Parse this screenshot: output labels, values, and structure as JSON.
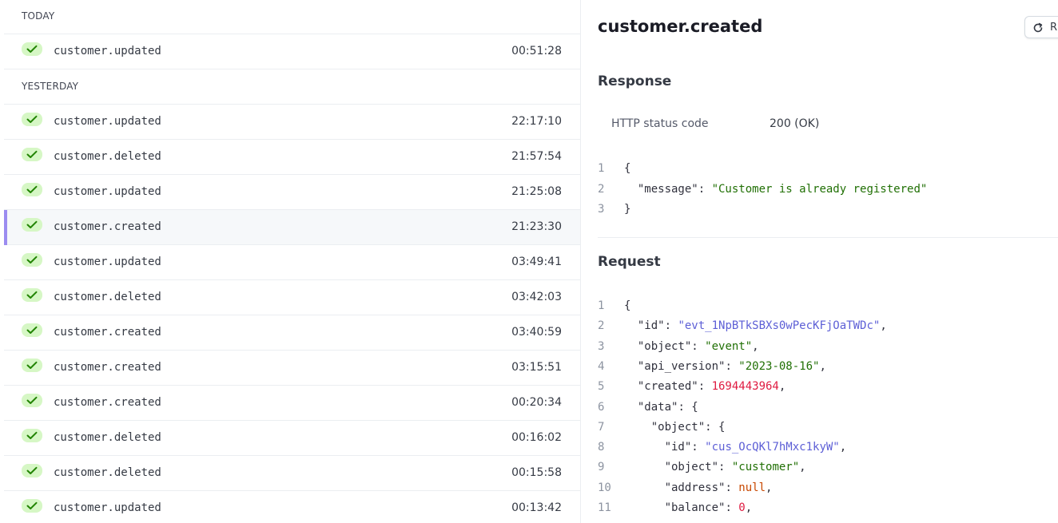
{
  "events_list": {
    "groups": [
      {
        "label": "TODAY",
        "rows": [
          {
            "name": "customer.updated",
            "time": "00:51:28"
          }
        ]
      },
      {
        "label": "YESTERDAY",
        "rows": [
          {
            "name": "customer.updated",
            "time": "22:17:10"
          },
          {
            "name": "customer.deleted",
            "time": "21:57:54"
          },
          {
            "name": "customer.updated",
            "time": "21:25:08"
          },
          {
            "name": "customer.created",
            "time": "21:23:30",
            "selected": true
          },
          {
            "name": "customer.updated",
            "time": "03:49:41"
          },
          {
            "name": "customer.deleted",
            "time": "03:42:03"
          },
          {
            "name": "customer.created",
            "time": "03:40:59"
          },
          {
            "name": "customer.created",
            "time": "03:15:51"
          },
          {
            "name": "customer.created",
            "time": "00:20:34"
          },
          {
            "name": "customer.deleted",
            "time": "00:16:02"
          },
          {
            "name": "customer.deleted",
            "time": "00:15:58"
          },
          {
            "name": "customer.updated",
            "time": "00:13:42"
          }
        ]
      }
    ],
    "status_icon": "check-icon"
  },
  "detail": {
    "title": "customer.created",
    "resend_label": "R",
    "resend_icon": "refresh-icon",
    "response": {
      "heading": "Response",
      "status_label": "HTTP status code",
      "status_value": "200 (OK)",
      "body_lines": [
        [
          [
            "{",
            "k"
          ]
        ],
        [
          [
            "  ",
            "k"
          ],
          [
            "\"message\"",
            "k"
          ],
          [
            ": ",
            "k"
          ],
          [
            "\"Customer is already registered\"",
            "s"
          ]
        ],
        [
          [
            "}",
            "k"
          ]
        ]
      ]
    },
    "request": {
      "heading": "Request",
      "body_lines": [
        [
          [
            "{",
            "k"
          ]
        ],
        [
          [
            "  \"id\"",
            "k"
          ],
          [
            ": ",
            "k"
          ],
          [
            "\"evt_1NpBTkSBXs0wPecKFjOaTWDc\"",
            "id"
          ],
          [
            ",",
            "k"
          ]
        ],
        [
          [
            "  \"object\"",
            "k"
          ],
          [
            ": ",
            "k"
          ],
          [
            "\"event\"",
            "s"
          ],
          [
            ",",
            "k"
          ]
        ],
        [
          [
            "  \"api_version\"",
            "k"
          ],
          [
            ": ",
            "k"
          ],
          [
            "\"2023-08-16\"",
            "s"
          ],
          [
            ",",
            "k"
          ]
        ],
        [
          [
            "  \"created\"",
            "k"
          ],
          [
            ": ",
            "k"
          ],
          [
            "1694443964",
            "n"
          ],
          [
            ",",
            "k"
          ]
        ],
        [
          [
            "  \"data\"",
            "k"
          ],
          [
            ": {",
            "k"
          ]
        ],
        [
          [
            "    \"object\"",
            "k"
          ],
          [
            ": {",
            "k"
          ]
        ],
        [
          [
            "      \"id\"",
            "k"
          ],
          [
            ": ",
            "k"
          ],
          [
            "\"cus_OcQKl7hMxc1kyW\"",
            "id"
          ],
          [
            ",",
            "k"
          ]
        ],
        [
          [
            "      \"object\"",
            "k"
          ],
          [
            ": ",
            "k"
          ],
          [
            "\"customer\"",
            "s"
          ],
          [
            ",",
            "k"
          ]
        ],
        [
          [
            "      \"address\"",
            "k"
          ],
          [
            ": ",
            "k"
          ],
          [
            "null",
            "nl"
          ],
          [
            ",",
            "k"
          ]
        ],
        [
          [
            "      \"balance\"",
            "k"
          ],
          [
            ": ",
            "k"
          ],
          [
            "0",
            "n"
          ],
          [
            ",",
            "k"
          ]
        ]
      ]
    }
  },
  "colors": {
    "accent": "#9b8cf0",
    "success_bg": "#d6f7c5",
    "success_check": "#228403",
    "string": "#217005",
    "id_link": "#5d5fd6",
    "number": "#df1b41",
    "null": "#c84801"
  }
}
